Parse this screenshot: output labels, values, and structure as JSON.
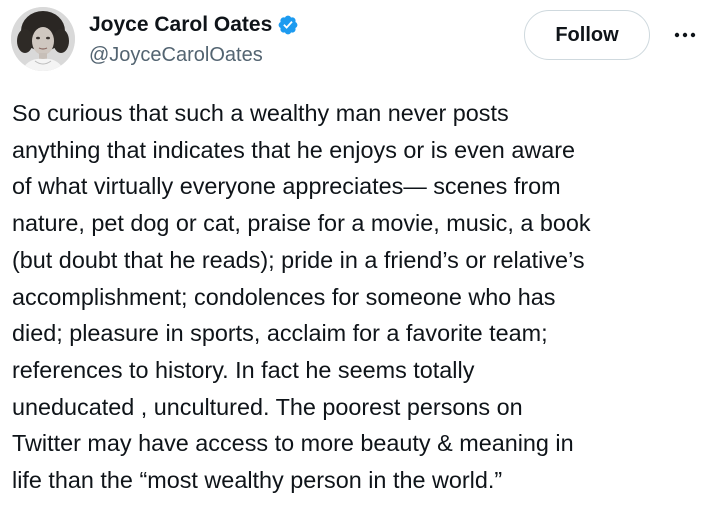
{
  "author": {
    "display_name": "Joyce Carol Oates",
    "handle": "@JoyceCarolOates",
    "verified": true,
    "verified_color": "#1d9bf0"
  },
  "actions": {
    "follow_label": "Follow",
    "more_icon": "more-horizontal-icon"
  },
  "tweet": {
    "lines": [
      "So curious that such a wealthy man never posts",
      "anything that indicates that he enjoys or is even aware",
      "of what virtually everyone appreciates— scenes from",
      "nature, pet dog or cat, praise for a movie, music, a book",
      "(but doubt that he reads); pride in a friend’s or relative’s",
      "accomplishment; condolences for someone who has",
      "died; pleasure in sports, acclaim for a favorite team;",
      "references to history.  In fact he seems totally",
      "uneducated , uncultured. The poorest persons on",
      "Twitter may have access to more beauty & meaning in",
      "life than the “most wealthy person in the world.”"
    ]
  },
  "colors": {
    "text": "#0f1419",
    "secondary_text": "#536471",
    "button_border": "#cfd9de"
  }
}
